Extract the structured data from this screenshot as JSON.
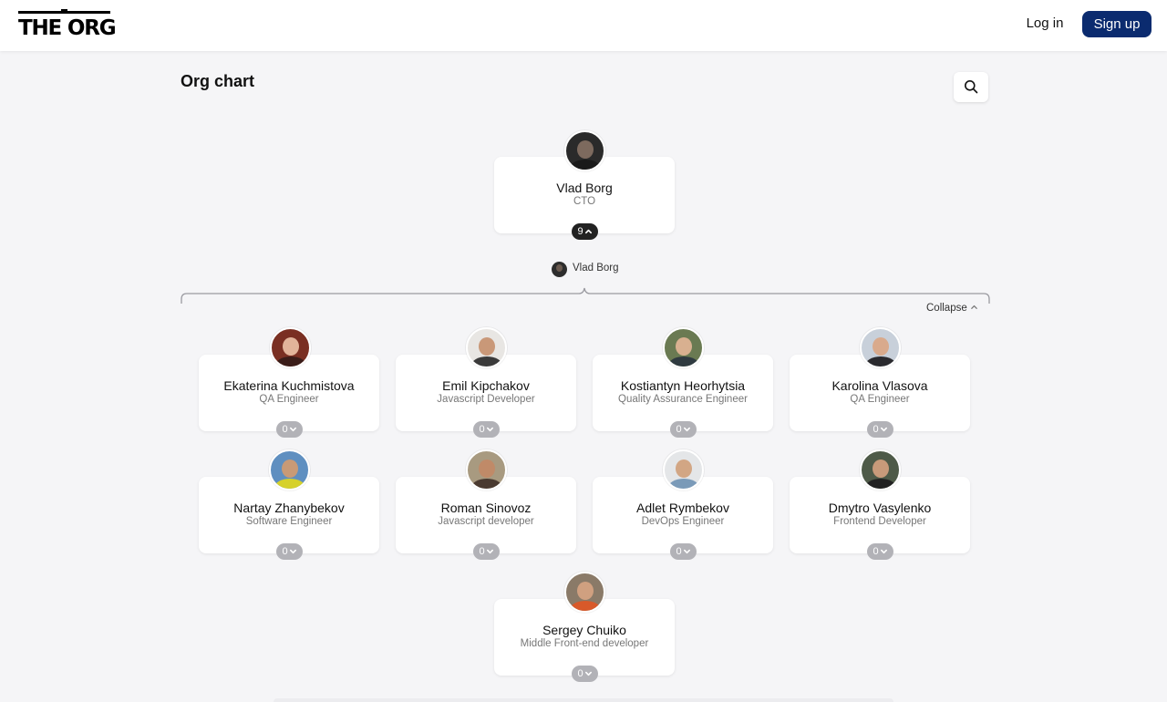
{
  "header": {
    "logo_text": "THE ORG",
    "login_label": "Log in",
    "signup_label": "Sign up",
    "brand_color": "#0b2b6f"
  },
  "page": {
    "title": "Org chart",
    "search_icon": "search-icon"
  },
  "root": {
    "name": "Vlad Borg",
    "role": "CTO",
    "reports_count": "9",
    "toggle_icon": "chevron-up-icon"
  },
  "manager_ref": {
    "name": "Vlad Borg"
  },
  "collapse_label": "Collapse",
  "reports": [
    {
      "name": "Ekaterina Kuchmistova",
      "role": "QA Engineer",
      "count": "0"
    },
    {
      "name": "Emil Kipchakov",
      "role": "Javascript Developer",
      "count": "0"
    },
    {
      "name": "Kostiantyn Heorhytsia",
      "role": "Quality Assurance Engineer",
      "count": "0"
    },
    {
      "name": "Karolina Vlasova",
      "role": "QA Engineer",
      "count": "0"
    },
    {
      "name": "Nartay Zhanybekov",
      "role": "Software Engineer",
      "count": "0"
    },
    {
      "name": "Roman Sinovoz",
      "role": "Javascript developer",
      "count": "0"
    },
    {
      "name": "Adlet Rymbekov",
      "role": "DevOps Engineer",
      "count": "0"
    },
    {
      "name": "Dmytro Vasylenko",
      "role": "Frontend Developer",
      "count": "0"
    },
    {
      "name": "Sergey Chuiko",
      "role": "Middle Front-end developer",
      "count": "0"
    }
  ]
}
